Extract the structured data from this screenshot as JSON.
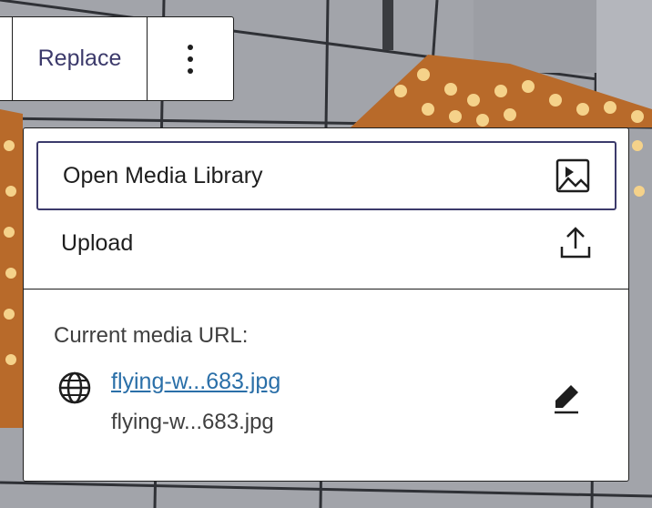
{
  "toolbar": {
    "replace_label": "Replace",
    "more_options_icon": "vertical-ellipsis-icon"
  },
  "menu": {
    "open_media_library_label": "Open Media Library",
    "open_media_library_icon": "image-icon",
    "upload_label": "Upload",
    "upload_icon": "upload-icon"
  },
  "current_media": {
    "label": "Current media URL:",
    "link_text": "flying-w...683.jpg",
    "filename": "flying-w...683.jpg",
    "globe_icon": "globe-icon",
    "edit_icon": "pencil-icon"
  },
  "colors": {
    "accent": "#3c3a6b",
    "link": "#2a6fa8",
    "text": "#1e1e1e",
    "border": "#1e1e1e"
  }
}
